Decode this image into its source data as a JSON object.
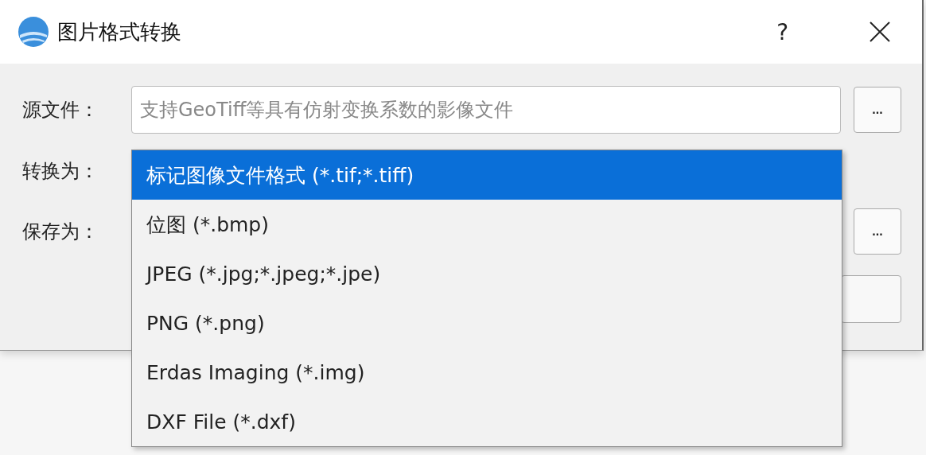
{
  "window": {
    "title": "图片格式转换",
    "help": "?"
  },
  "form": {
    "source": {
      "label": "源文件：",
      "placeholder": "支持GeoTiff等具有仿射变换系数的影像文件",
      "browse": "..."
    },
    "convert": {
      "label": "转换为："
    },
    "save": {
      "label": "保存为：",
      "browse": "..."
    }
  },
  "dropdown": {
    "items": [
      {
        "label": "标记图像文件格式 (*.tif;*.tiff)",
        "selected": true
      },
      {
        "label": "位图 (*.bmp)",
        "selected": false
      },
      {
        "label": "JPEG (*.jpg;*.jpeg;*.jpe)",
        "selected": false
      },
      {
        "label": "PNG (*.png)",
        "selected": false
      },
      {
        "label": "Erdas Imaging (*.img)",
        "selected": false
      },
      {
        "label": "DXF File (*.dxf)",
        "selected": false
      }
    ]
  }
}
